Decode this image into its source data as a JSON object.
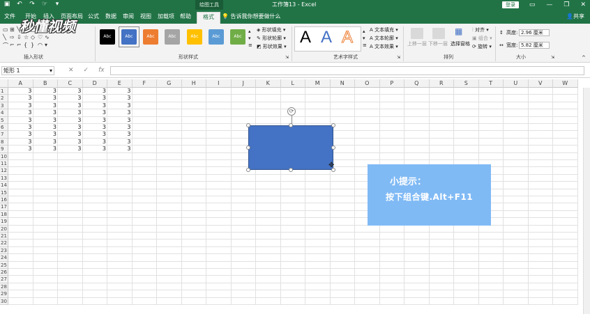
{
  "titlebar": {
    "context_group": "绘图工具",
    "title": "工作簿13 - Excel",
    "login": "登录",
    "qat_icons": [
      "save-icon",
      "undo-icon",
      "redo-icon",
      "touch-icon",
      "customize-icon"
    ],
    "window_buttons": [
      "ribbon-display-icon",
      "minimize-icon",
      "restore-icon",
      "close-icon"
    ]
  },
  "tabs": [
    {
      "label": "文件",
      "active": false
    },
    {
      "label": "开始",
      "active": false
    },
    {
      "label": "插入",
      "active": false
    },
    {
      "label": "页面布局",
      "active": false
    },
    {
      "label": "公式",
      "active": false
    },
    {
      "label": "数据",
      "active": false
    },
    {
      "label": "审阅",
      "active": false
    },
    {
      "label": "视图",
      "active": false
    },
    {
      "label": "加载项",
      "active": false
    },
    {
      "label": "帮助",
      "active": false
    },
    {
      "label": "格式",
      "active": true
    }
  ],
  "tell_me": "告诉我你想要做什么",
  "share": "共享",
  "ribbon": {
    "groups": {
      "insert_shapes": "插入形状",
      "shape_styles": "形状样式",
      "wordart_styles": "艺术字样式",
      "arrange": "排列",
      "size": "大小"
    },
    "style_swatches": [
      {
        "label": "Abc",
        "color": "#000000"
      },
      {
        "label": "Abc",
        "color": "#4472c4"
      },
      {
        "label": "Abc",
        "color": "#ed7d31"
      },
      {
        "label": "Abc",
        "color": "#a5a5a5"
      },
      {
        "label": "Abc",
        "color": "#ffc000"
      },
      {
        "label": "Abc",
        "color": "#5b9bd5"
      },
      {
        "label": "Abc",
        "color": "#70ad47"
      }
    ],
    "shape_cmds": {
      "fill": "形状填充",
      "outline": "形状轮廓",
      "effects": "形状效果"
    },
    "wordart_letter": "A",
    "text_cmds": {
      "fill": "文本填充",
      "outline": "文本轮廓",
      "effects": "文本效果"
    },
    "arrange_cmds": {
      "bring_forward": "上移一层",
      "send_backward": "下移一层",
      "selection_pane": "选择窗格",
      "align": "对齐",
      "group": "组合",
      "rotate": "旋转"
    },
    "size": {
      "height_label": "高度:",
      "height_value": "2.96 厘米",
      "width_label": "宽度:",
      "width_value": "5.82 厘米"
    }
  },
  "formula_bar": {
    "name_box": "矩形 1",
    "fx": "fx",
    "cancel": "✕",
    "enter": "✓",
    "formula": ""
  },
  "sheet": {
    "columns": [
      "A",
      "B",
      "C",
      "D",
      "E",
      "F",
      "G",
      "H",
      "I",
      "J",
      "K",
      "L",
      "M",
      "N",
      "O",
      "P",
      "Q",
      "R",
      "S",
      "T",
      "U",
      "V",
      "W"
    ],
    "rows": [
      "1",
      "2",
      "3",
      "4",
      "5",
      "6",
      "7",
      "8",
      "9",
      "10",
      "11",
      "12",
      "13",
      "14",
      "15",
      "16",
      "17",
      "18",
      "19",
      "20",
      "21",
      "22",
      "23",
      "24",
      "25",
      "26",
      "27",
      "28",
      "29",
      "30"
    ],
    "cell_value": "3",
    "data_rows": 9,
    "data_cols": 5
  },
  "tip": {
    "title": "小提示：",
    "body": "按下组合键.Alt+F11"
  },
  "logo": "秒懂视频"
}
